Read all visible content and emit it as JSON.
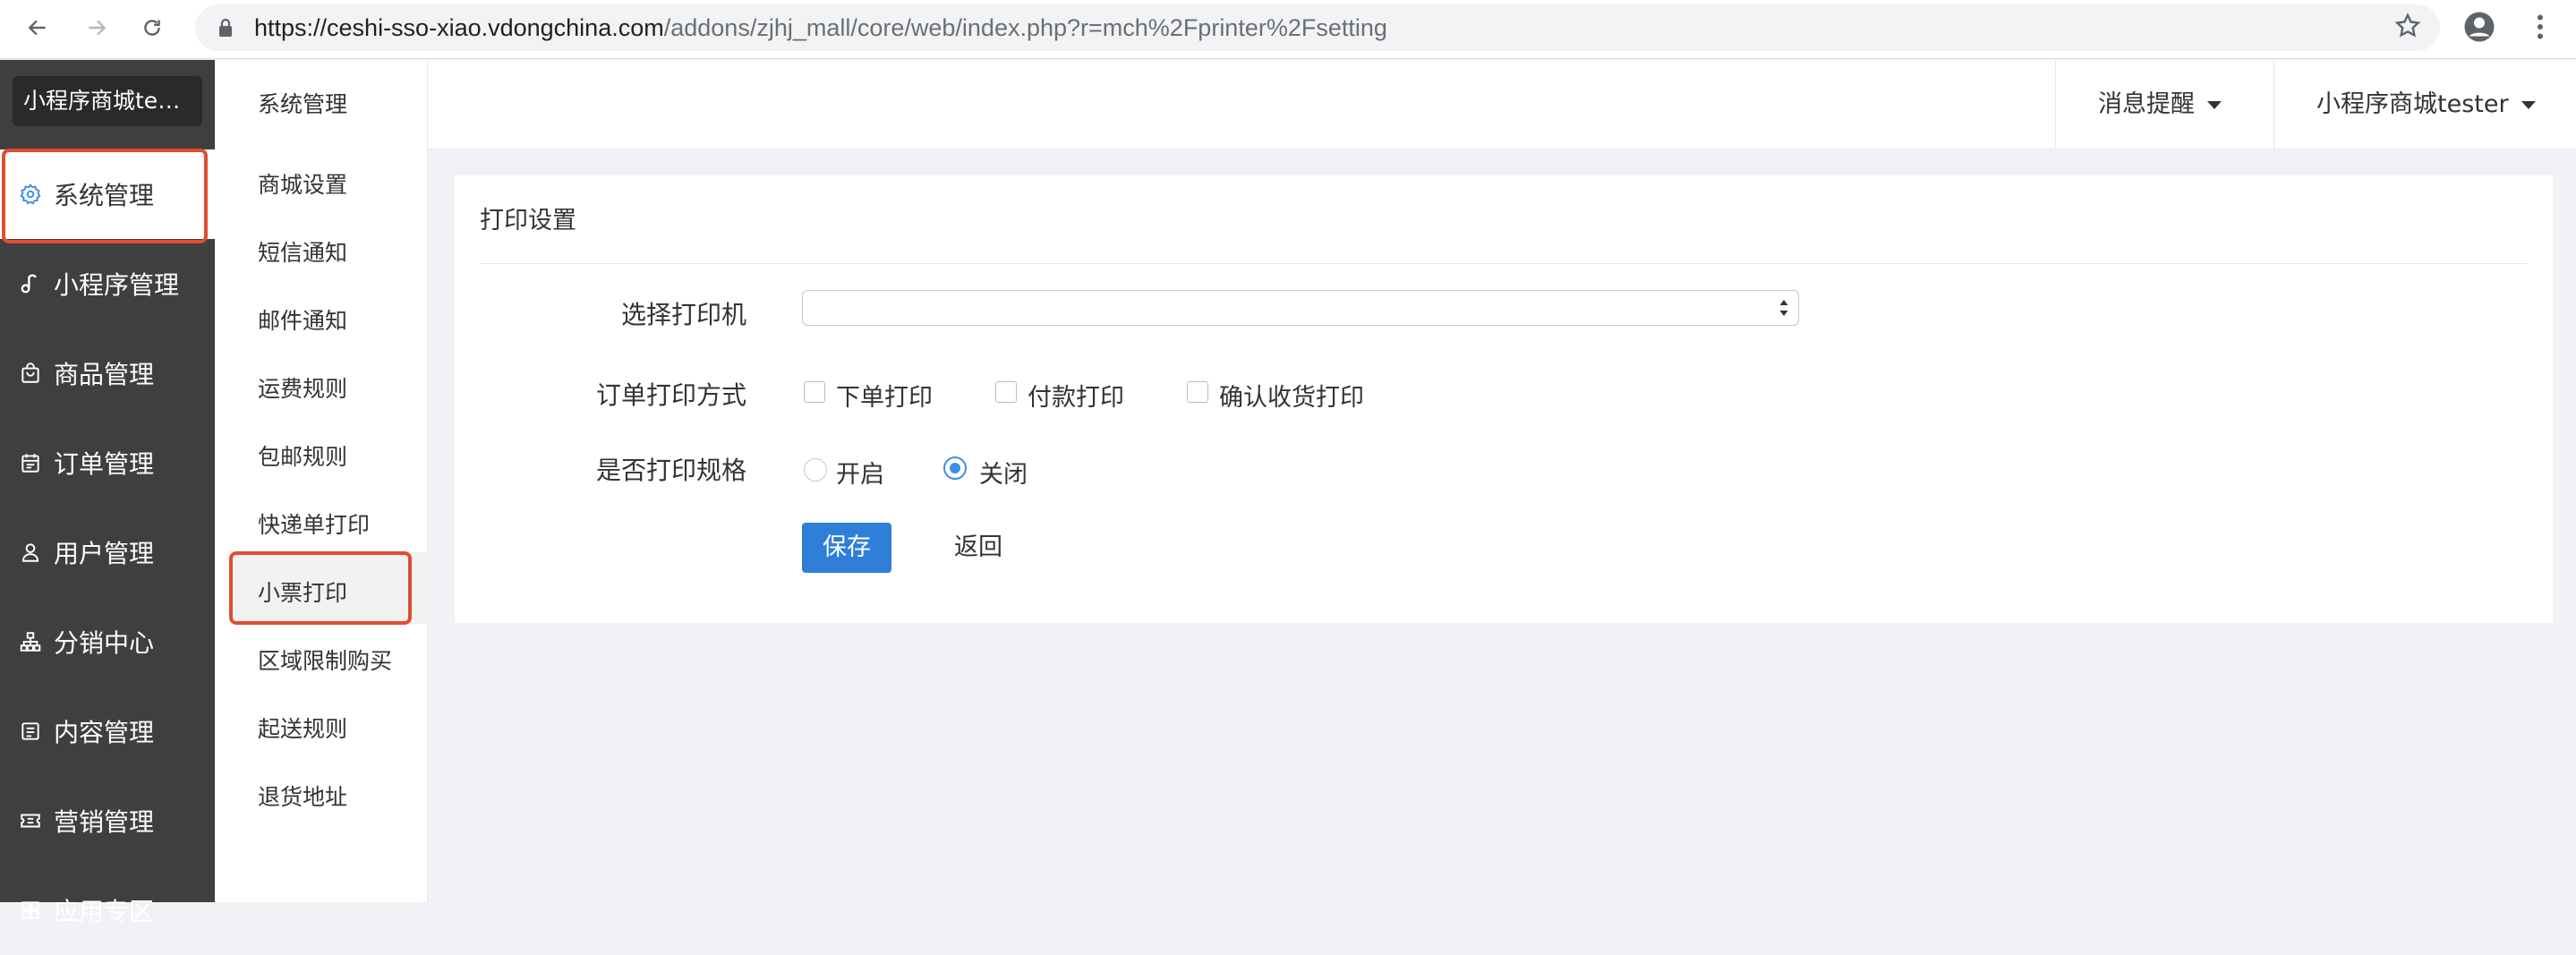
{
  "browser": {
    "url_host": "https://ceshi-sso-xiao.vdongchina.com",
    "url_path": "/addons/zjhj_mall/core/web/index.php?r=mch%2Fprinter%2Fsetting"
  },
  "sidebar": {
    "brand": "小程序商城tester",
    "items": [
      {
        "label": "系统管理",
        "icon": "gear-icon",
        "active": true
      },
      {
        "label": "小程序管理",
        "icon": "music-note-icon"
      },
      {
        "label": "商品管理",
        "icon": "shopping-bag-icon"
      },
      {
        "label": "订单管理",
        "icon": "calendar-icon"
      },
      {
        "label": "用户管理",
        "icon": "user-icon"
      },
      {
        "label": "分销中心",
        "icon": "network-icon"
      },
      {
        "label": "内容管理",
        "icon": "document-icon"
      },
      {
        "label": "营销管理",
        "icon": "ticket-icon"
      },
      {
        "label": "应用专区",
        "icon": "apps-icon"
      }
    ]
  },
  "submenu": {
    "title": "系统管理",
    "items": [
      "商城设置",
      "短信通知",
      "邮件通知",
      "运费规则",
      "包邮规则",
      "快递单打印",
      "小票打印",
      "区域限制购买",
      "起送规则",
      "退货地址"
    ],
    "active": "小票打印"
  },
  "header": {
    "messages": "消息提醒",
    "user": "小程序商城tester"
  },
  "form": {
    "title": "打印设置",
    "printer_label": "选择打印机",
    "printer_value": "",
    "mode_label": "订单打印方式",
    "mode_options": [
      "下单打印",
      "付款打印",
      "确认收货打印"
    ],
    "spec_label": "是否打印规格",
    "spec_options": [
      "开启",
      "关闭"
    ],
    "spec_selected": "关闭",
    "save": "保存",
    "back": "返回"
  },
  "colors": {
    "sidebar_bg": "#3f3f3f",
    "accent": "#2f7fd8",
    "highlight": "#e04e2f"
  }
}
